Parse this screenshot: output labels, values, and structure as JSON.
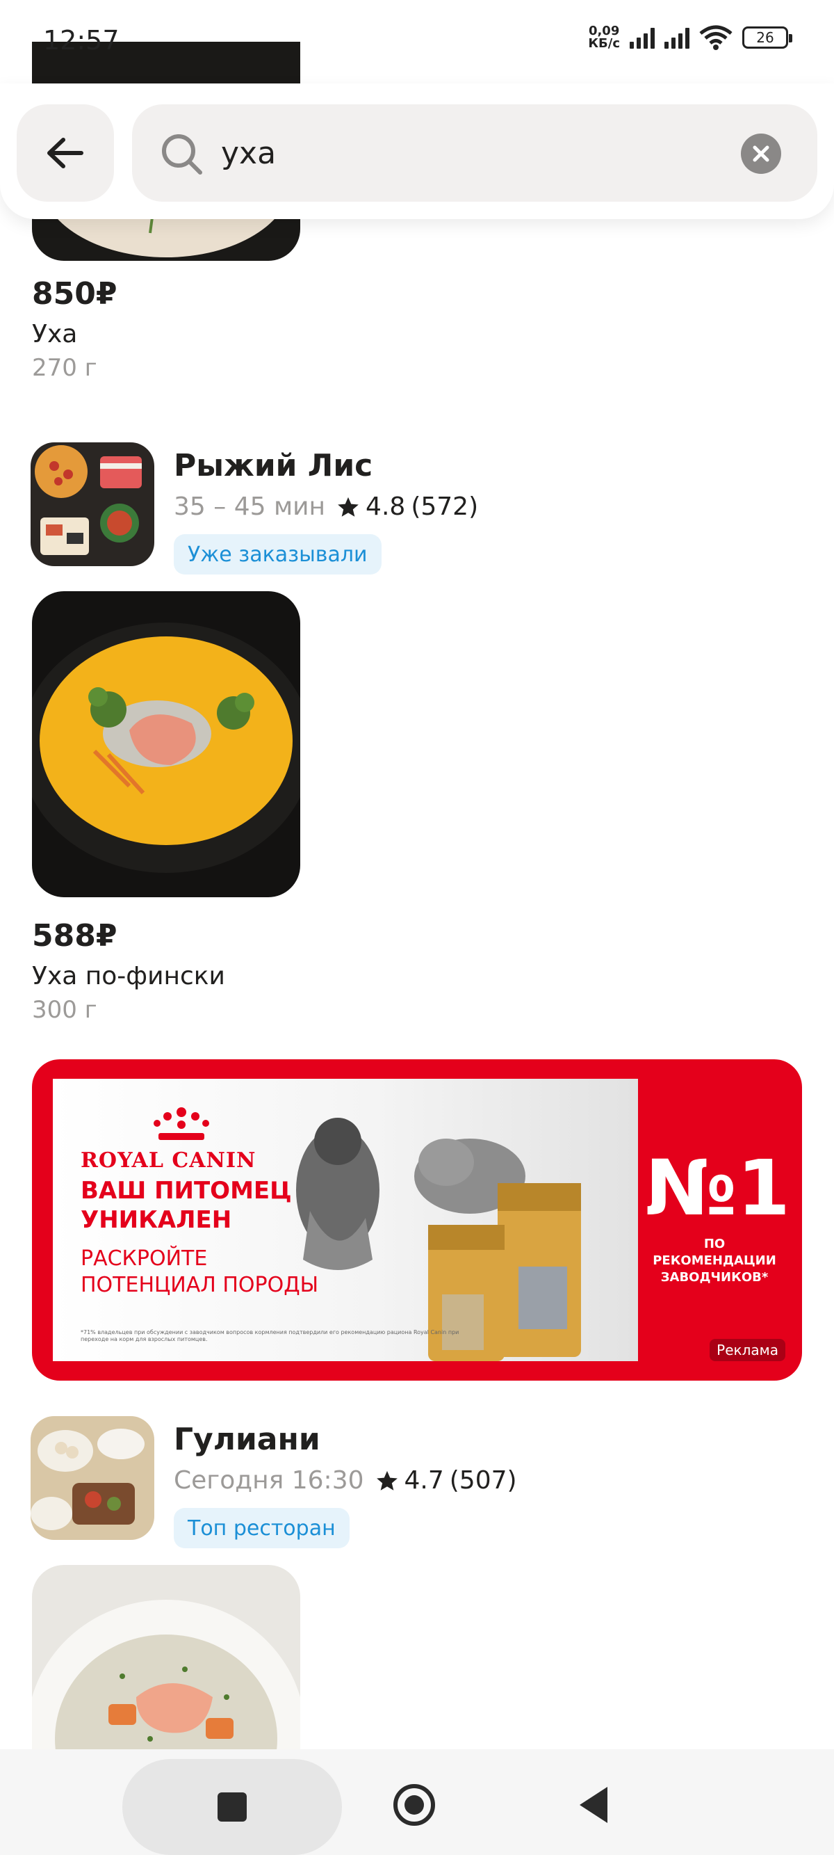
{
  "status_bar": {
    "time": "12:57",
    "net_speed_value": "0,09",
    "net_speed_unit": "КБ/с",
    "battery": "26"
  },
  "search": {
    "query": "уха",
    "back_icon": "arrow-left-icon",
    "search_icon": "magnifier-icon",
    "clear_icon": "close-circle-icon"
  },
  "results": {
    "first_dish": {
      "price": "850₽",
      "name": "Уха",
      "weight": "270 г"
    },
    "restaurants": [
      {
        "name": "Рыжий Лис",
        "delivery": "35 – 45 мин",
        "rating": "4.8",
        "reviews": "(572)",
        "badge": "Уже заказывали",
        "dish": {
          "price": "588₽",
          "name": "Уха по-фински",
          "weight": "300 г"
        }
      },
      {
        "name": "Гулиани",
        "delivery": "Сегодня 16:30",
        "rating": "4.7",
        "reviews": "(507)",
        "badge": "Топ ресторан"
      }
    ]
  },
  "ad": {
    "brand": "ROYAL CANIN",
    "headline_1": "ВАШ ПИТОМЕЦ",
    "headline_2": "УНИКАЛЕН",
    "sub_1": "РАСКРОЙТЕ",
    "sub_2": "ПОТЕНЦИАЛ ПОРОДЫ",
    "number": "№1",
    "rec_1": "ПО РЕКОМЕНДАЦИИ",
    "rec_2": "ЗАВОДЧИКОВ*",
    "label": "Реклама",
    "accent_color": "#e4001b"
  },
  "colors": {
    "badge_text": "#1b8fd6",
    "badge_bg": "#e6f3fb",
    "muted_text": "#9c9a98"
  }
}
